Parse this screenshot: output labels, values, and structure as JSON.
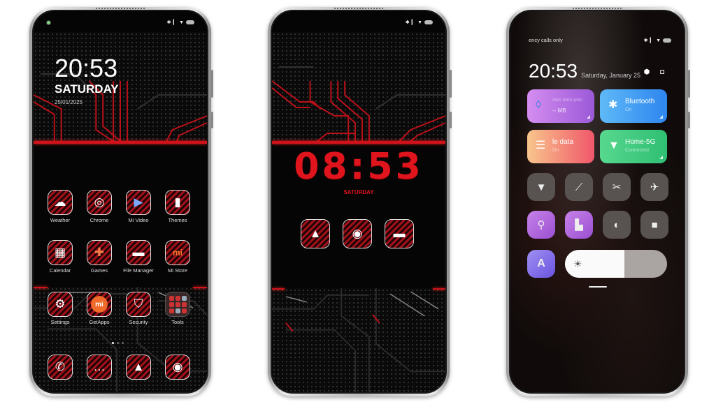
{
  "phone1": {
    "status_icons": [
      "bluetooth-icon",
      "signal-icon",
      "wifi-icon",
      "battery-icon"
    ],
    "clock": {
      "time": "20:53",
      "day": "SATURDAY",
      "date": "25/01/2025"
    },
    "apps_row1": [
      {
        "label": "Weather",
        "icon": "weather-icon",
        "glyph": "☁"
      },
      {
        "label": "Chrome",
        "icon": "chrome-icon",
        "glyph": "◎"
      },
      {
        "label": "Mi Video",
        "icon": "mi-video-icon",
        "glyph": "▶"
      },
      {
        "label": "Themes",
        "icon": "themes-icon",
        "glyph": "▮"
      }
    ],
    "apps_row2": [
      {
        "label": "Calendar",
        "icon": "calendar-icon",
        "glyph": "▦"
      },
      {
        "label": "Games",
        "icon": "games-icon",
        "glyph": "✚"
      },
      {
        "label": "File Manager",
        "icon": "folder-icon",
        "glyph": "▬"
      },
      {
        "label": "Mi Store",
        "icon": "mi-store-icon",
        "glyph": "mi"
      }
    ],
    "apps_row3": [
      {
        "label": "Settings",
        "icon": "settings-icon",
        "glyph": "⚙"
      },
      {
        "label": "GetApps",
        "icon": "getapps-icon",
        "glyph": "mi"
      },
      {
        "label": "Security",
        "icon": "shield-icon",
        "glyph": "⛉"
      },
      {
        "label": "Tools",
        "icon": "tools-folder-icon",
        "glyph": "▦"
      }
    ],
    "page_indicator": {
      "pages": 3,
      "current": 1
    },
    "dock": [
      {
        "label": "Phone",
        "icon": "phone-icon",
        "glyph": "✆"
      },
      {
        "label": "Messages",
        "icon": "message-icon",
        "glyph": "…"
      },
      {
        "label": "Gallery",
        "icon": "gallery-icon",
        "glyph": "▲"
      },
      {
        "label": "Camera",
        "icon": "camera-icon",
        "glyph": "◉"
      }
    ]
  },
  "phone2": {
    "status_icons": [
      "bluetooth-icon",
      "signal-icon",
      "wifi-icon",
      "battery-icon"
    ],
    "clock": {
      "time": "08:53",
      "day": "SATURDAY"
    },
    "apps": [
      {
        "label": "Gallery",
        "icon": "gallery-icon",
        "glyph": "▲"
      },
      {
        "label": "Camera",
        "icon": "camera-icon",
        "glyph": "◉"
      },
      {
        "label": "File Manager",
        "icon": "folder-icon",
        "glyph": "▬"
      }
    ]
  },
  "phone3": {
    "carrier_text": "ency calls only",
    "status_icons": [
      "bluetooth-icon",
      "signal-icon",
      "wifi-icon",
      "battery-icon"
    ],
    "clock": {
      "time": "20:53",
      "date": "Saturday, January 25"
    },
    "tiles": [
      {
        "title": "own data plan",
        "sub": "-- MB",
        "icon": "data-drop-icon",
        "glyph": "💧",
        "colors": [
          "#d58df0",
          "#9b59d8"
        ]
      },
      {
        "title": "Bluetooth",
        "sub": "On",
        "icon": "bluetooth-icon",
        "glyph": "✱",
        "colors": [
          "#5fb9f7",
          "#2e86ef"
        ]
      },
      {
        "title": "le data",
        "sub": "On",
        "icon": "mobile-data-icon",
        "glyph": "⇅",
        "colors": [
          "#f8c58c",
          "#f0576a"
        ]
      },
      {
        "title": "Home-5G",
        "sub": "Connected",
        "icon": "wifi-icon",
        "glyph": "◠",
        "colors": [
          "#57d88f",
          "#2fbf73"
        ]
      }
    ],
    "quick_buttons": [
      {
        "name": "flashlight-icon",
        "glyph": "▼",
        "active": false
      },
      {
        "name": "auto-rotate-icon",
        "glyph": "⟋",
        "active": false
      },
      {
        "name": "screenshot-icon",
        "glyph": "✂",
        "active": false
      },
      {
        "name": "airplane-icon",
        "glyph": "✈",
        "active": false
      },
      {
        "name": "location-icon",
        "glyph": "⚲",
        "active": true
      },
      {
        "name": "screen-cast-icon",
        "glyph": "▙",
        "active": true
      },
      {
        "name": "dark-mode-icon",
        "glyph": "◐",
        "active": false
      },
      {
        "name": "video-record-icon",
        "glyph": "■",
        "active": false
      }
    ],
    "auto_brightness_label": "A",
    "brightness_percent": 58
  }
}
